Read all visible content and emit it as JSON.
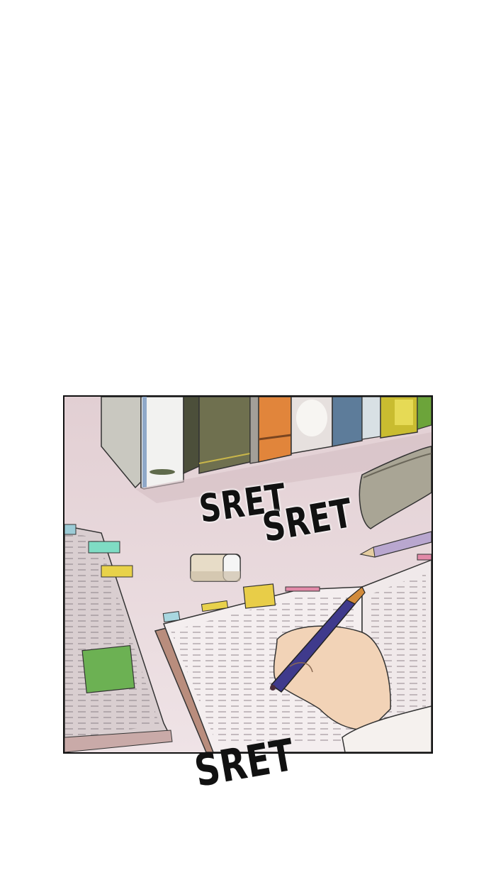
{
  "sound_effects": {
    "top_left": "SRET",
    "top_right": "SRET",
    "bottom": "SRET"
  },
  "colors": {
    "background": "#ffffff",
    "desk": "#e9d9dc",
    "panel_border": "#111111"
  }
}
